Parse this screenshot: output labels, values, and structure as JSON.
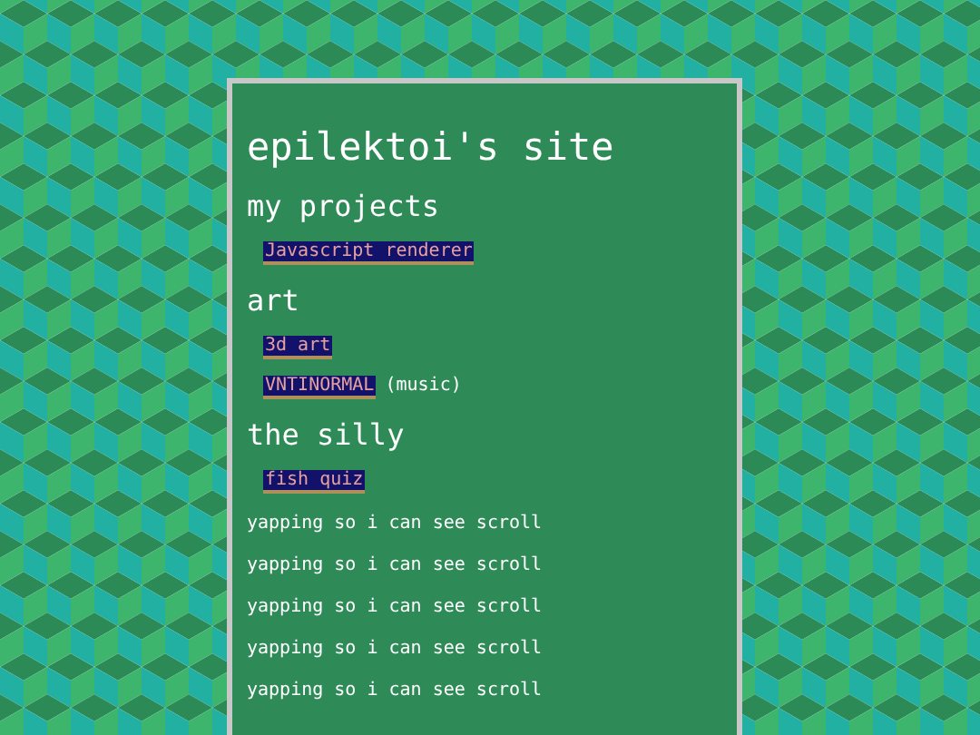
{
  "title": "epilektoi's site",
  "sections": [
    {
      "heading": "my projects",
      "items": [
        {
          "link": "Javascript renderer"
        }
      ]
    },
    {
      "heading": "art",
      "items": [
        {
          "link": "3d art"
        },
        {
          "link": "VNTINORMAL",
          "note": "(music)"
        }
      ]
    },
    {
      "heading": "the silly",
      "items": [
        {
          "link": "fish quiz"
        }
      ]
    }
  ],
  "paragraphs": [
    "yapping so i can see scroll",
    "yapping so i can see scroll",
    "yapping so i can see scroll",
    "yapping so i can see scroll",
    "yapping so i can see scroll"
  ]
}
